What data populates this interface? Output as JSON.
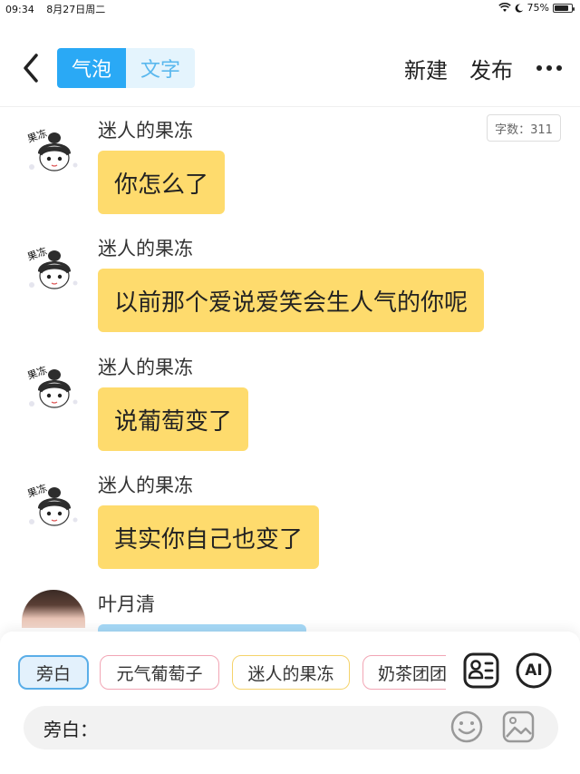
{
  "status_bar": {
    "time": "09:34",
    "date": "8月27日周二",
    "battery": "75%"
  },
  "nav": {
    "tabs": [
      {
        "label": "气泡"
      },
      {
        "label": "文字"
      }
    ],
    "new_label": "新建",
    "publish_label": "发布",
    "icons": {
      "back": "chevron-left-icon",
      "more": "more-icon"
    }
  },
  "word_count": "字数：311",
  "messages": [
    {
      "name": "迷人的果冻",
      "text": "你怎么了"
    },
    {
      "name": "迷人的果冻",
      "text": "以前那个爱说爱笑会生人气的你呢"
    },
    {
      "name": "迷人的果冻",
      "text": "说葡萄变了"
    },
    {
      "name": "迷人的果冻",
      "text": "其实你自己也变了"
    },
    {
      "name": "叶月清",
      "text": ""
    }
  ],
  "characters": [
    {
      "label": "旁白"
    },
    {
      "label": "元气葡萄子"
    },
    {
      "label": "迷人的果冻"
    },
    {
      "label": "奶茶团团"
    }
  ],
  "tools": {
    "roles_icon": "contacts-icon",
    "ai_label": "AI"
  },
  "input": {
    "label": "旁白：",
    "value": ""
  },
  "colors": {
    "accent": "#2aa9f5",
    "bubble_yellow": "#fedb6d",
    "bubble_blue": "#a6d9f7"
  }
}
